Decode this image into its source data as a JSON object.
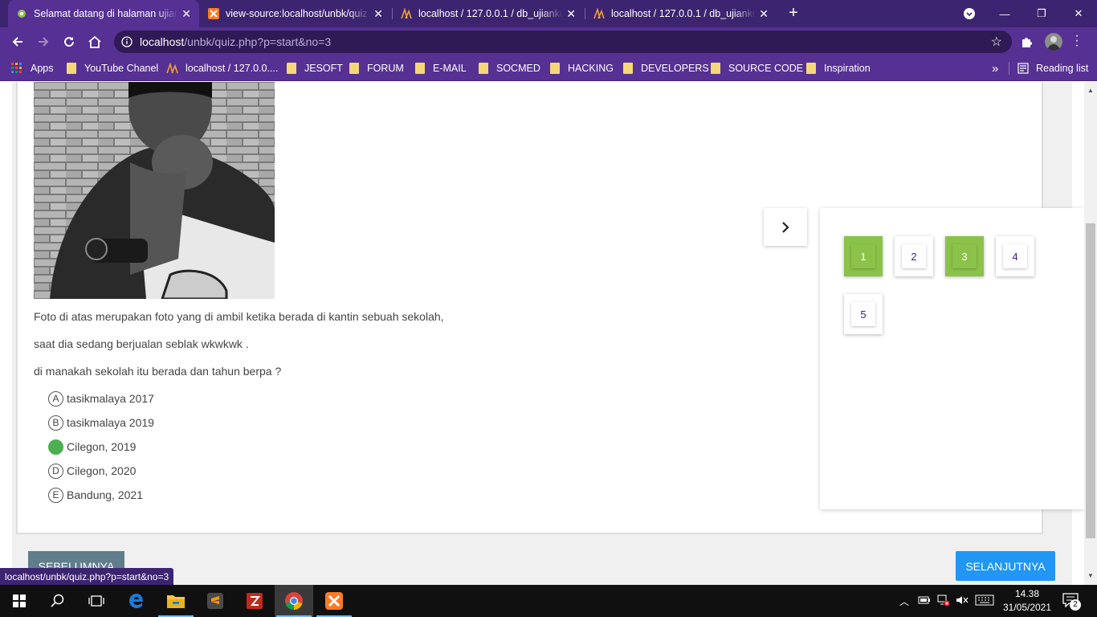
{
  "browser": {
    "tabs": [
      {
        "title": "Selamat datang di halaman ujian",
        "active": true
      },
      {
        "title": "view-source:localhost/unbk/quiz.",
        "active": false
      },
      {
        "title": "localhost / 127.0.0.1 / db_ujianku",
        "active": false
      },
      {
        "title": "localhost / 127.0.0.1 / db_ujianku",
        "active": false
      }
    ],
    "url_host": "localhost",
    "url_path": "/unbk/quiz.php?p=start&no=3",
    "bookmarks": [
      {
        "label": "Apps",
        "icon": "apps-grid-icon"
      },
      {
        "label": "YouTube Chanel",
        "icon": "folder-icon"
      },
      {
        "label": "localhost / 127.0.0....",
        "icon": "phpmyadmin-icon"
      },
      {
        "label": "JESOFT",
        "icon": "folder-icon"
      },
      {
        "label": "FORUM",
        "icon": "folder-icon"
      },
      {
        "label": "E-MAIL",
        "icon": "folder-icon"
      },
      {
        "label": "SOCMED",
        "icon": "folder-icon"
      },
      {
        "label": "HACKING",
        "icon": "folder-icon"
      },
      {
        "label": "DEVELOPERS",
        "icon": "folder-icon"
      },
      {
        "label": "SOURCE CODE",
        "icon": "folder-icon"
      },
      {
        "label": "Inspiration",
        "icon": "folder-icon"
      }
    ],
    "overflow": "»",
    "reading_list": "Reading list",
    "status_url": "localhost/unbk/quiz.php?p=start&no=3"
  },
  "quiz": {
    "question_lines": [
      "Foto di atas merupakan foto yang di ambil ketika berada di kantin sebuah sekolah,",
      "saat dia sedang berjualan seblak wkwkwk .",
      "di manakah sekolah itu berada dan tahun berpa ?"
    ],
    "options": [
      {
        "letter": "A",
        "text": "tasikmalaya 2017",
        "selected": false
      },
      {
        "letter": "B",
        "text": "tasikmalaya 2019",
        "selected": false
      },
      {
        "letter": "C",
        "text": "Cilegon, 2019",
        "selected": true
      },
      {
        "letter": "D",
        "text": "Cilegon, 2020",
        "selected": false
      },
      {
        "letter": "E",
        "text": "Bandung, 2021",
        "selected": false
      }
    ],
    "numbers": [
      {
        "label": "1",
        "answered": true
      },
      {
        "label": "2",
        "answered": false
      },
      {
        "label": "3",
        "answered": true
      },
      {
        "label": "4",
        "answered": false
      },
      {
        "label": "5",
        "answered": false
      }
    ],
    "prev_label": "SEBELUMNYA",
    "next_label": "SELANJUTNYA"
  },
  "taskbar": {
    "time": "14.38",
    "date": "31/05/2021",
    "notifications": "2"
  },
  "colors": {
    "chrome_dark": "#3d2470",
    "chrome": "#563093",
    "answered": "#8bc34a",
    "selected_option": "#4caf50",
    "next_button": "#2196f3",
    "prev_button": "#607d8b"
  }
}
